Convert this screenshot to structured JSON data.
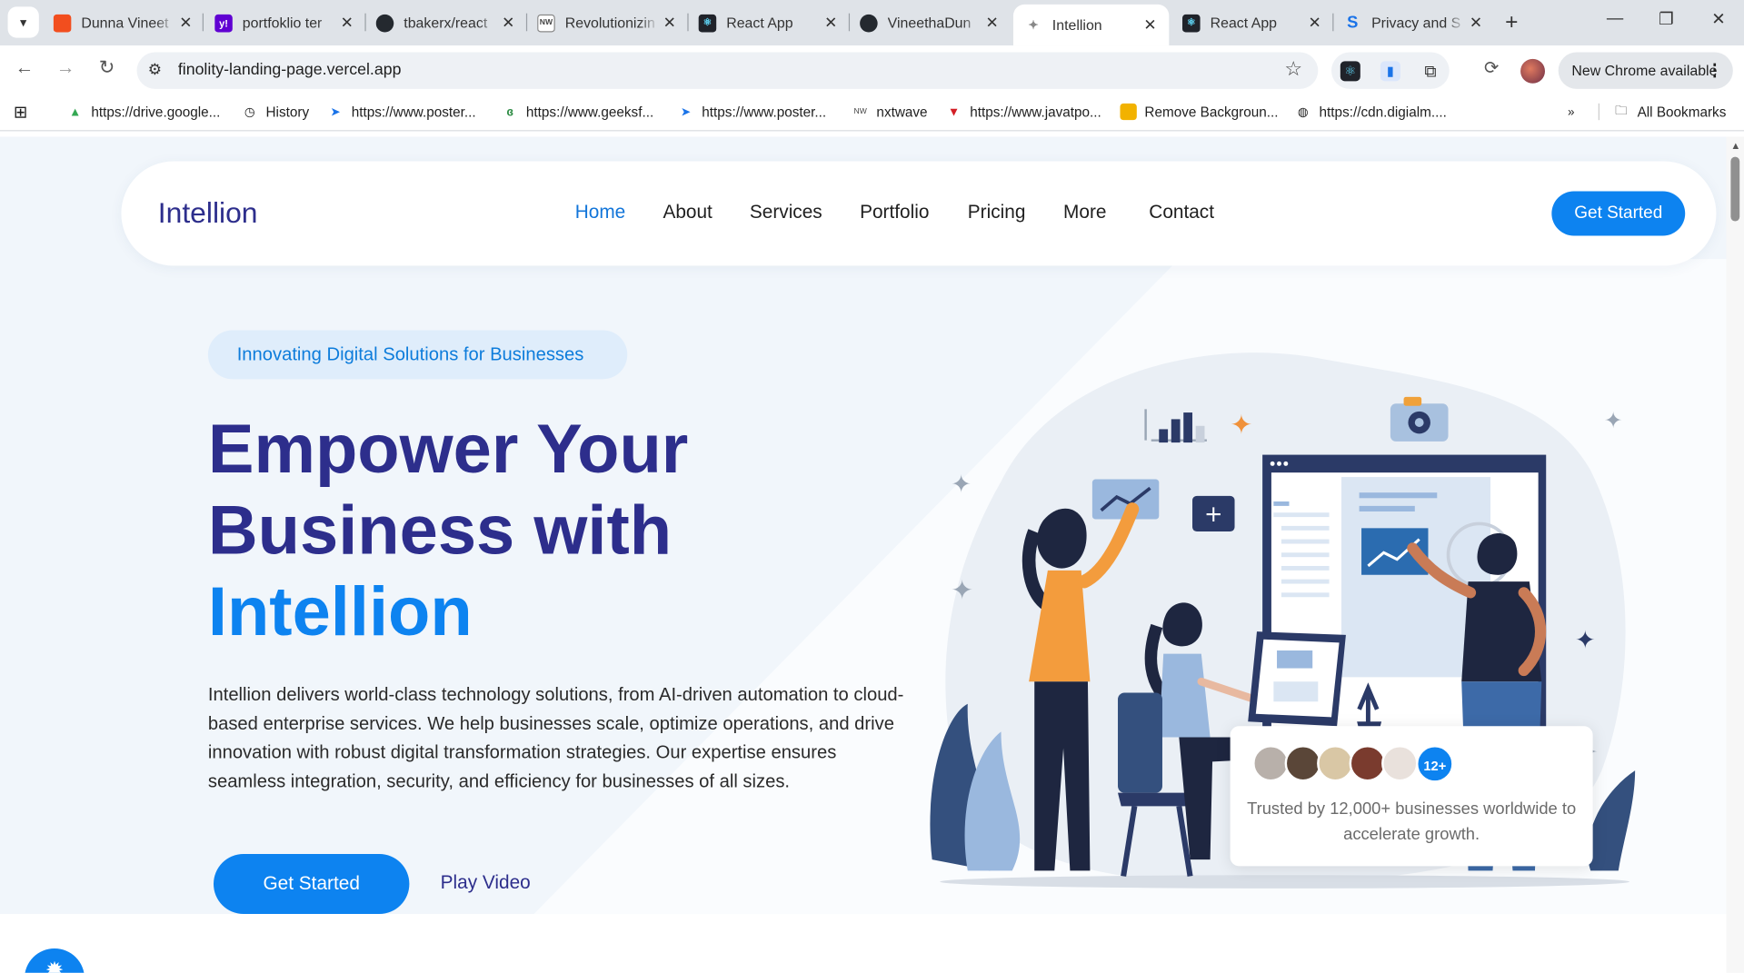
{
  "browser": {
    "tabs": [
      {
        "title": "Dunna Vineet",
        "icon": "figma-icon",
        "color": "#f24e1e"
      },
      {
        "title": "portfoklio ter",
        "icon": "yahoo-icon",
        "color": "#6001d2"
      },
      {
        "title": "tbakerx/react",
        "icon": "github-icon",
        "color": "#24292f"
      },
      {
        "title": "Revolutionizin",
        "icon": "nxtwave-icon",
        "color": "#444444"
      },
      {
        "title": "React App",
        "icon": "react-icon",
        "color": "#20232a"
      },
      {
        "title": "VineethaDun",
        "icon": "github-icon",
        "color": "#24292f"
      },
      {
        "title": "Intellion",
        "icon": "globe-icon",
        "color": "#888888"
      },
      {
        "title": "React App",
        "icon": "react-icon",
        "color": "#20232a"
      },
      {
        "title": "Privacy and S",
        "icon": "s-icon",
        "color": "#1a73e8"
      }
    ],
    "active_tab_index": 6,
    "url": "finolity-landing-page.vercel.app",
    "update_label": "New Chrome available",
    "bookmarks": [
      {
        "label": "https://drive.google...",
        "icon": "google-drive-icon"
      },
      {
        "label": "History",
        "icon": "history-icon"
      },
      {
        "label": "https://www.poster...",
        "icon": "postman-icon"
      },
      {
        "label": "https://www.geeksf...",
        "icon": "geeksforgeeks-icon"
      },
      {
        "label": "https://www.poster...",
        "icon": "postman-icon"
      },
      {
        "label": "nxtwave",
        "icon": "nxtwave-icon"
      },
      {
        "label": "https://www.javatpo...",
        "icon": "javatpoint-icon"
      },
      {
        "label": "Remove Backgroun...",
        "icon": "remove-bg-icon"
      },
      {
        "label": "https://cdn.digialm....",
        "icon": "globe-icon"
      }
    ],
    "all_bookmarks_label": "All Bookmarks"
  },
  "site": {
    "brand": "Intellion",
    "nav": [
      "Home",
      "About",
      "Services",
      "Portfolio",
      "Pricing",
      "More",
      "Contact"
    ],
    "active_nav": "Home",
    "nav_cta": "Get Started",
    "badge": "Innovating Digital Solutions for Businesses",
    "headline_line1": "Empower Your",
    "headline_line2": "Business with",
    "headline_accent": "Intellion",
    "description": "Intellion delivers world-class technology solutions, from AI-driven automation to cloud-based enterprise services. We help businesses scale, optimize operations, and drive innovation with robust digital transformation strategies. Our expertise ensures seamless integration, security, and efficiency for businesses of all sizes.",
    "cta_primary": "Get Started",
    "cta_secondary": "Play Video",
    "trust_count_badge": "12+",
    "trust_text": "Trusted by 12,000+ businesses worldwide to accelerate growth.",
    "colors": {
      "primary": "#0d83f0",
      "navy": "#2d2e8c",
      "hero_bg": "#f1f6fb",
      "badge_bg": "#dfedfb"
    }
  }
}
